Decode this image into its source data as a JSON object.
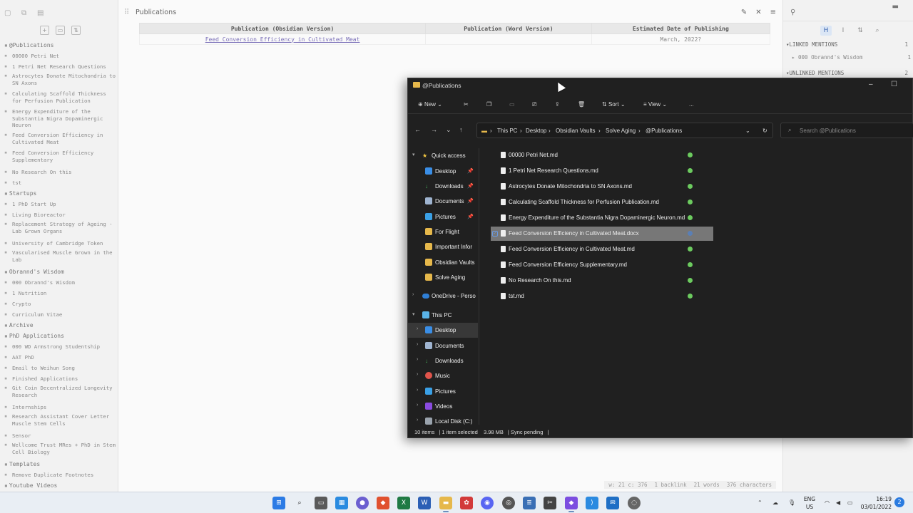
{
  "obsidian": {
    "editor_title": "Publications",
    "table": {
      "headers": [
        "Publication (Obsidian Version)",
        "Publication (Word Version)",
        "Estimated Date of Publishing"
      ],
      "rows": [
        [
          "Feed Conversion Efficiency in Cultivated Meat",
          "",
          "March, 2022?"
        ]
      ]
    },
    "tree": [
      {
        "type": "folder",
        "label": "@Publications"
      },
      {
        "type": "file",
        "label": "00000 Petri Net"
      },
      {
        "type": "file",
        "label": "1 Petri Net Research Questions"
      },
      {
        "type": "file",
        "label": "Astrocytes Donate Mitochondria to SN Axons",
        "wrap": true
      },
      {
        "type": "file",
        "label": "Calculating Scaffold Thickness for Perfusion Publication",
        "wrap": true
      },
      {
        "type": "file",
        "label": "Energy Expenditure of the Substantia Nigra Dopaminergic Neuron",
        "wrap": 3
      },
      {
        "type": "file",
        "label": "Feed Conversion Efficiency in Cultivated Meat",
        "wrap": true
      },
      {
        "type": "file",
        "label": "Feed Conversion Efficiency Supplementary",
        "wrap": true
      },
      {
        "type": "file",
        "label": "No Research On this"
      },
      {
        "type": "file",
        "label": "tst"
      },
      {
        "type": "folder",
        "label": "Startups"
      },
      {
        "type": "file",
        "label": "1 PhD Start Up"
      },
      {
        "type": "file",
        "label": "Living Bioreactor"
      },
      {
        "type": "file",
        "label": "Replacement Strategy of Ageing - Lab Grown Organs",
        "wrap": true
      },
      {
        "type": "file",
        "label": "University of Cambridge Token"
      },
      {
        "type": "file",
        "label": "Vascularised Muscle Grown in the Lab",
        "wrap": true
      },
      {
        "type": "folder",
        "label": "Obrannd's Wisdom"
      },
      {
        "type": "file",
        "label": "000 Obrannd's Wisdom"
      },
      {
        "type": "file",
        "label": "1 Nutrition"
      },
      {
        "type": "file",
        "label": "Crypto"
      },
      {
        "type": "file",
        "label": "Curriculum Vitae"
      },
      {
        "type": "folder",
        "label": "Archive"
      },
      {
        "type": "folder",
        "label": "PhD Applications"
      },
      {
        "type": "file",
        "label": "000 WD Armstrong Studentship"
      },
      {
        "type": "file",
        "label": "AAT PhD"
      },
      {
        "type": "file",
        "label": "Email to Weihun Song"
      },
      {
        "type": "file",
        "label": "Finished Applications"
      },
      {
        "type": "file",
        "label": "Git Coin Decentralized Longevity Research",
        "wrap": true
      },
      {
        "type": "file",
        "label": "Internships"
      },
      {
        "type": "file",
        "label": "Research Assistant Cover Letter Muscle Stem Cells",
        "wrap": true
      },
      {
        "type": "file",
        "label": "Sensor"
      },
      {
        "type": "file",
        "label": "Wellcome Trust MRes + PhD in Stem Cell Biology",
        "wrap": true
      },
      {
        "type": "folder",
        "label": "Templates"
      },
      {
        "type": "file",
        "label": "Remove Duplicate Footnotes"
      },
      {
        "type": "folder",
        "label": "Youtube Videos"
      }
    ],
    "backlinks": {
      "linked_label": "LINKED MENTIONS",
      "linked_count": "1",
      "linked_item": "000 Obrannd's Wisdom",
      "linked_item_count": "1",
      "unlinked_label": "UNLINKED MENTIONS",
      "unlinked_count": "2"
    },
    "status": {
      "position": "w: 21 c: 376",
      "backlinks": "1 backlink",
      "words": "21 words",
      "chars": "376 characters"
    }
  },
  "explorer": {
    "window_title": "@Publications",
    "commands": {
      "new": "New",
      "sort": "Sort",
      "view": "View",
      "more": "..."
    },
    "breadcrumb": [
      "This PC",
      "Desktop",
      "Obsidian Vaults",
      "Solve Aging",
      "@Publications"
    ],
    "search_placeholder": "Search @Publications",
    "nav": {
      "quick_access": "Quick access",
      "desktop": "Desktop",
      "downloads": "Downloads",
      "documents": "Documents",
      "pictures": "Pictures",
      "for_flight": "For Flight",
      "important": "Important Infor",
      "obsidian_vaults": "Obsidian Vaults",
      "solve_aging": "Solve Aging",
      "onedrive": "OneDrive - Perso",
      "this_pc": "This PC",
      "pc_desktop": "Desktop",
      "pc_documents": "Documents",
      "pc_downloads": "Downloads",
      "pc_music": "Music",
      "pc_pictures": "Pictures",
      "pc_videos": "Videos",
      "pc_local_disk": "Local Disk (C:)"
    },
    "files": [
      "00000 Petri Net.md",
      "1 Petri Net Research Questions.md",
      "Astrocytes Donate Mitochondria to SN Axons.md",
      "Calculating Scaffold Thickness for Perfusion Publication.md",
      "Energy Expenditure of the Substantia Nigra Dopaminergic Neuron.md",
      "Feed Conversion Efficiency in Cultivated Meat.docx",
      "Feed Conversion Efficiency in Cultivated Meat.md",
      "Feed Conversion Efficiency Supplementary.md",
      "No Research On this.md",
      "tst.md"
    ],
    "status": {
      "items": "10 items",
      "selected": "1 item selected",
      "size": "3.98 MB",
      "sync": "Sync pending"
    }
  },
  "taskbar": {
    "lang_top": "ENG",
    "lang_bottom": "US",
    "time": "16:19",
    "date": "03/01/2022",
    "notifications": "2"
  }
}
